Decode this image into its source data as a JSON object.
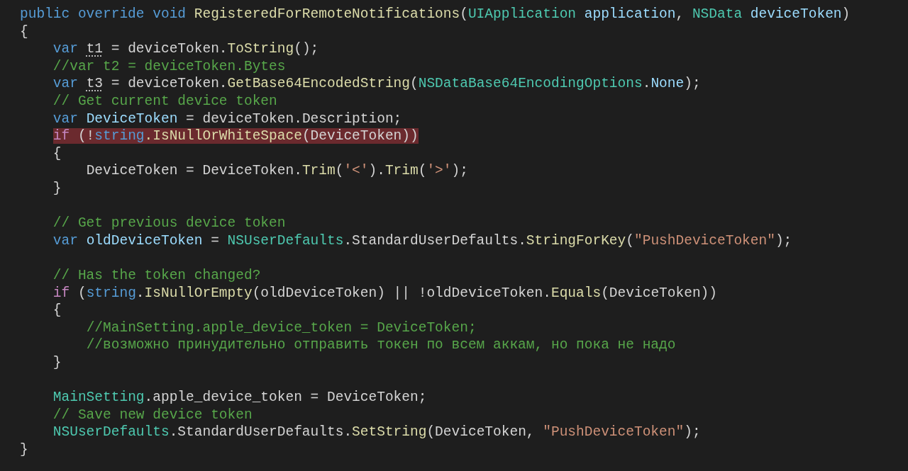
{
  "editor": {
    "blocks": [
      {
        "lines": [
          {
            "tokens": [
              {
                "text": "public override void ",
                "kind": "keyword"
              },
              {
                "text": "RegisteredForRemoteNotifications",
                "kind": "function"
              },
              {
                "text": "(",
                "kind": "plain"
              },
              {
                "text": "UIApplication",
                "kind": "type"
              },
              {
                "text": " application",
                "kind": "variable"
              },
              {
                "text": ", ",
                "kind": "plain"
              },
              {
                "text": "NSData",
                "kind": "type"
              },
              {
                "text": " deviceToken",
                "kind": "variable"
              },
              {
                "text": ")",
                "kind": "plain"
              }
            ]
          },
          {
            "tokens": [
              {
                "text": "{",
                "kind": "plain"
              }
            ]
          },
          {
            "tokens": [
              {
                "text": "    var ",
                "kind": "keyword"
              },
              {
                "text": "t1",
                "kind": "plain",
                "warning": true
              },
              {
                "text": " = deviceToken.",
                "kind": "plain"
              },
              {
                "text": "ToString",
                "kind": "function"
              },
              {
                "text": "();",
                "kind": "plain"
              }
            ]
          },
          {
            "tokens": [
              {
                "text": "    //var t2 = deviceToken.Bytes",
                "kind": "comment"
              }
            ]
          },
          {
            "tokens": [
              {
                "text": "    var ",
                "kind": "keyword"
              },
              {
                "text": "t3",
                "kind": "plain",
                "warning": true
              },
              {
                "text": " = deviceToken.",
                "kind": "plain"
              },
              {
                "text": "GetBase64EncodedString",
                "kind": "function"
              },
              {
                "text": "(",
                "kind": "plain"
              },
              {
                "text": "NSDataBase64EncodingOptions",
                "kind": "type"
              },
              {
                "text": ".",
                "kind": "plain"
              },
              {
                "text": "None",
                "kind": "variable"
              },
              {
                "text": ");",
                "kind": "plain"
              }
            ]
          },
          {
            "tokens": [
              {
                "text": "    // Get current device token",
                "kind": "comment"
              }
            ]
          },
          {
            "tokens": [
              {
                "text": "    var ",
                "kind": "keyword"
              },
              {
                "text": "DeviceToken",
                "kind": "variable"
              },
              {
                "text": " = deviceToken.Description;",
                "kind": "plain"
              }
            ]
          },
          {
            "highlighted": true,
            "tokens": [
              {
                "text": "    if",
                "kind": "control"
              },
              {
                "text": " (!",
                "kind": "plain"
              },
              {
                "text": "string",
                "kind": "keyword"
              },
              {
                "text": ".IsNullOrWhiteSpace",
                "kind": "function"
              },
              {
                "text": "(DeviceToken))",
                "kind": "plain"
              }
            ]
          },
          {
            "tokens": [
              {
                "text": "    {",
                "kind": "plain"
              }
            ]
          },
          {
            "tokens": [
              {
                "text": "        DeviceToken = DeviceToken.",
                "kind": "plain"
              },
              {
                "text": "Trim",
                "kind": "function"
              },
              {
                "text": "(",
                "kind": "plain"
              },
              {
                "text": "'<'",
                "kind": "string"
              },
              {
                "text": ").",
                "kind": "plain"
              },
              {
                "text": "Trim",
                "kind": "function"
              },
              {
                "text": "(",
                "kind": "plain"
              },
              {
                "text": "'>'",
                "kind": "string"
              },
              {
                "text": ");",
                "kind": "plain"
              }
            ]
          },
          {
            "tokens": [
              {
                "text": "    }",
                "kind": "plain"
              }
            ]
          }
        ]
      },
      {
        "lines": [
          {
            "tokens": [
              {
                "text": "    // Get previous device token",
                "kind": "comment"
              }
            ]
          },
          {
            "tokens": [
              {
                "text": "    var ",
                "kind": "keyword"
              },
              {
                "text": "oldDeviceToken",
                "kind": "variable"
              },
              {
                "text": " = ",
                "kind": "plain"
              },
              {
                "text": "NSUserDefaults",
                "kind": "type"
              },
              {
                "text": ".StandardUserDefaults.",
                "kind": "plain"
              },
              {
                "text": "StringForKey",
                "kind": "function"
              },
              {
                "text": "(",
                "kind": "plain"
              },
              {
                "text": "\"PushDeviceToken\"",
                "kind": "string"
              },
              {
                "text": ");",
                "kind": "plain"
              }
            ]
          }
        ]
      },
      {
        "lines": [
          {
            "tokens": [
              {
                "text": "    // Has the token changed?",
                "kind": "comment"
              }
            ]
          },
          {
            "tokens": [
              {
                "text": "    if",
                "kind": "control"
              },
              {
                "text": " (",
                "kind": "plain"
              },
              {
                "text": "string",
                "kind": "keyword"
              },
              {
                "text": ".",
                "kind": "plain"
              },
              {
                "text": "IsNullOrEmpty",
                "kind": "function"
              },
              {
                "text": "(oldDeviceToken) || !oldDeviceToken.",
                "kind": "plain"
              },
              {
                "text": "Equals",
                "kind": "function"
              },
              {
                "text": "(DeviceToken))",
                "kind": "plain"
              }
            ]
          },
          {
            "tokens": [
              {
                "text": "    {",
                "kind": "plain"
              }
            ]
          },
          {
            "tokens": [
              {
                "text": "        //MainSetting.apple_device_token = DeviceToken;",
                "kind": "comment"
              }
            ]
          },
          {
            "tokens": [
              {
                "text": "        //возможно принудительно отправить токен по всем аккам, но пока не надо",
                "kind": "comment"
              }
            ]
          },
          {
            "tokens": [
              {
                "text": "    }",
                "kind": "plain"
              }
            ]
          }
        ]
      },
      {
        "lines": [
          {
            "tokens": [
              {
                "text": "    MainSetting",
                "kind": "type"
              },
              {
                "text": ".apple_device_token = DeviceToken;",
                "kind": "plain"
              }
            ]
          },
          {
            "tokens": [
              {
                "text": "    // Save new device token",
                "kind": "comment"
              }
            ]
          },
          {
            "tokens": [
              {
                "text": "    NSUserDefaults",
                "kind": "type"
              },
              {
                "text": ".StandardUserDefaults.",
                "kind": "plain"
              },
              {
                "text": "SetString",
                "kind": "function"
              },
              {
                "text": "(DeviceToken, ",
                "kind": "plain"
              },
              {
                "text": "\"PushDeviceToken\"",
                "kind": "string"
              },
              {
                "text": ");",
                "kind": "plain"
              }
            ]
          },
          {
            "tokens": [
              {
                "text": "}",
                "kind": "plain"
              }
            ]
          }
        ]
      }
    ]
  }
}
